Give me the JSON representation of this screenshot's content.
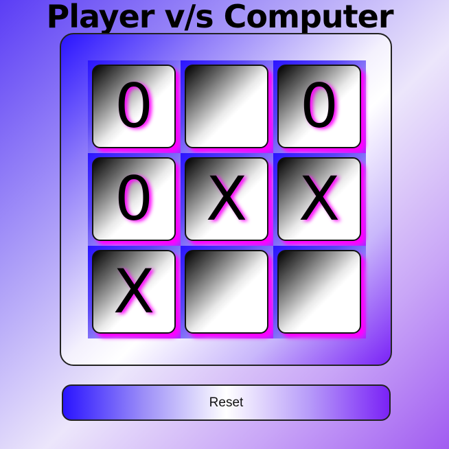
{
  "title": "Player v/s Computer",
  "board": {
    "cells": [
      "0",
      "",
      "0",
      "0",
      "X",
      "X",
      "X",
      "",
      ""
    ]
  },
  "reset_label": "Reset",
  "colors": {
    "accent_blue": "#2a14ff",
    "accent_purple": "#7a22f6",
    "glow_magenta": "#ff00ff"
  }
}
